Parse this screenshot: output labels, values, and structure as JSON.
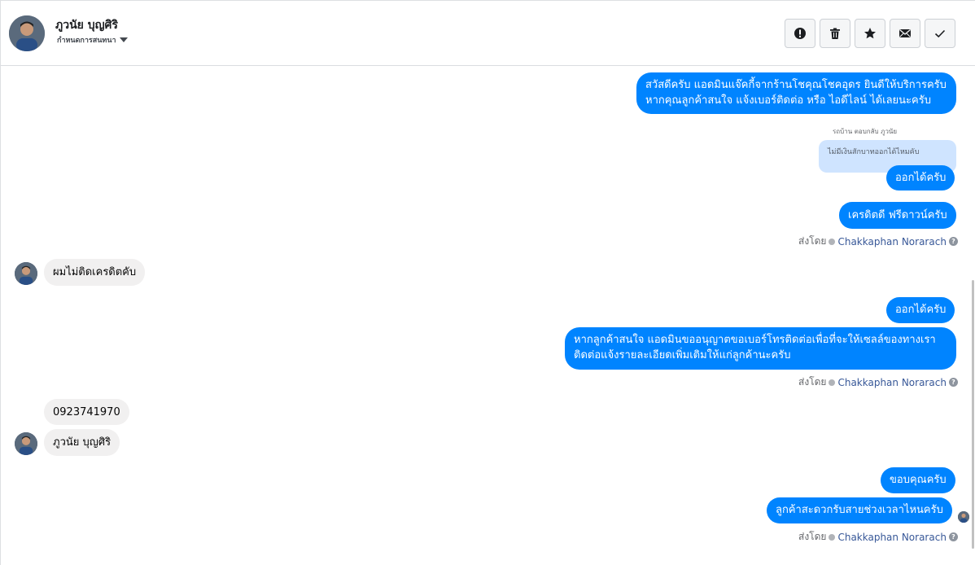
{
  "header": {
    "name": "ภูวนัย บุญศิริ",
    "subtitle": "กำหนดการสนทนา",
    "actions": [
      {
        "name": "report",
        "icon": "exclamation-icon"
      },
      {
        "name": "delete",
        "icon": "trash-icon"
      },
      {
        "name": "star",
        "icon": "star-icon"
      },
      {
        "name": "mark-unread",
        "icon": "envelope-icon"
      },
      {
        "name": "mark-done",
        "icon": "checkmark-icon"
      }
    ]
  },
  "messages": {
    "m1_line1": "สวัสดีครับ แอดมินแจ๊คกี้จากร้านโชคุณโชคอุดร ยินดีให้บริการครับ",
    "m1_line2": "หากคุณลูกค้าสนใจ แจ้งเบอร์ติดต่อ หรือ ไอดีไลน์ ได้เลยนะครับ",
    "reply_meta": "รถบ้าน ตอบกลับ ภูวนัย",
    "quoted": "ไม่มีเงินสักบาทออกได้ไหมคับ",
    "m2": "ออกได้ครับ",
    "m3": "เครดิตดี ฟรีดาวน์ครับ",
    "in1": "ผมไม่ติดเครดิตคับ",
    "m4": "ออกได้ครับ",
    "m5_line1": "หากลูกค้าสนใจ แอดมินขออนุญาตขอเบอร์โทรติดต่อเพื่อที่จะให้เซลล์ของทางเรา",
    "m5_line2": "ติดต่อแจ้งรายละเอียดเพิ่มเติมให้แก่ลูกค้านะครับ",
    "in2": "0923741970",
    "in3": "ภูวนัย บุญศิริ",
    "m6": "ขอบคุณครับ",
    "m7": "ลูกค้าสะดวกรับสายช่วงเวลาไหนครับ"
  },
  "sent_by": {
    "label": "ส่งโดย",
    "agent": "Chakkaphan Norarach",
    "help": "?"
  },
  "colors": {
    "outgoing": "#0084ff",
    "incoming": "#f1f0f0",
    "quoted": "#cfe4ff",
    "agent_link": "#385898"
  }
}
